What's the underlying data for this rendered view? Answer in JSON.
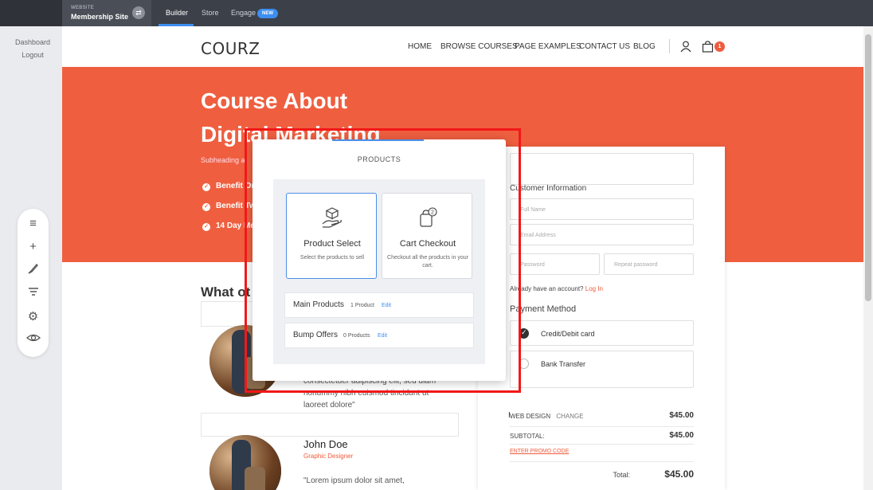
{
  "topbar": {
    "site_label_small": "WEBSITE",
    "site_label": "Membership Site",
    "switch_icon": "swap-arrows-icon",
    "nav": [
      {
        "label": "Builder",
        "active": true
      },
      {
        "label": "Store",
        "active": false
      },
      {
        "label": "Engage",
        "active": false
      }
    ],
    "new_badge": "NEW",
    "accent": "#3d8ef0"
  },
  "sidebar": {
    "links": [
      "Dashboard",
      "Logout"
    ],
    "tools": [
      "menu-icon",
      "plus-icon",
      "brush-icon",
      "filter-icon",
      "gear-icon",
      "eye-icon"
    ]
  },
  "site": {
    "logo": "COURZ",
    "nav": [
      "HOME",
      "BROWSE COURSES",
      "PAGE EXAMPLES",
      "CONTACT US",
      "BLOG"
    ],
    "cart_count": "1",
    "brand_color": "#ef5f3f"
  },
  "hero": {
    "title_line1": "Course About",
    "title_line2": "Digital Marketing",
    "subheading": "Subheading al",
    "benefits": [
      "Benefit On",
      "Benefit Tw",
      "14 Day Mo"
    ]
  },
  "testimonials": {
    "heading": "What ot",
    "quote1": [
      "consectetuer adipiscing elit, sed diam",
      "nonummy nibh euismod tincidunt ut",
      "laoreet dolore\""
    ],
    "name": "John Doe",
    "role": "Graphic Designer",
    "quote2": [
      "\"Lorem ipsum dolor sit amet,"
    ]
  },
  "checkout": {
    "customer_info": "Customer Information",
    "fields": {
      "full_name": "Full Name",
      "email": "Email Address",
      "password": "Password",
      "repeat_password": "Repeat password"
    },
    "login_prompt": "Already have an account?",
    "login_link": "Log In",
    "payment_method": "Payment Method",
    "payment_options": [
      {
        "label": "Credit/Debit card",
        "selected": true
      },
      {
        "label": "Bank Transfer",
        "selected": false
      }
    ],
    "item_name": "WEB DESIGN",
    "change_label": "CHANGE",
    "item_price": "$45.00",
    "subtotal_label": "SUBTOTAL:",
    "subtotal": "$45.00",
    "promo": "ENTER PROMO CODE",
    "total_label": "Total:",
    "total": "$45.00"
  },
  "modal": {
    "title": "PRODUCTS",
    "cards": [
      {
        "title": "Product Select",
        "desc": "Select the products to sell",
        "icon": "hand-box-icon",
        "selected": true
      },
      {
        "title": "Cart Checkout",
        "desc": "Checkout all the products in your cart.",
        "icon": "cart-bag-icon",
        "selected": false
      }
    ],
    "rows": [
      {
        "name": "Main Products",
        "count": "1 Product",
        "edit": "Edit"
      },
      {
        "name": "Bump Offers",
        "count": "0 Products",
        "edit": "Edit"
      }
    ]
  }
}
